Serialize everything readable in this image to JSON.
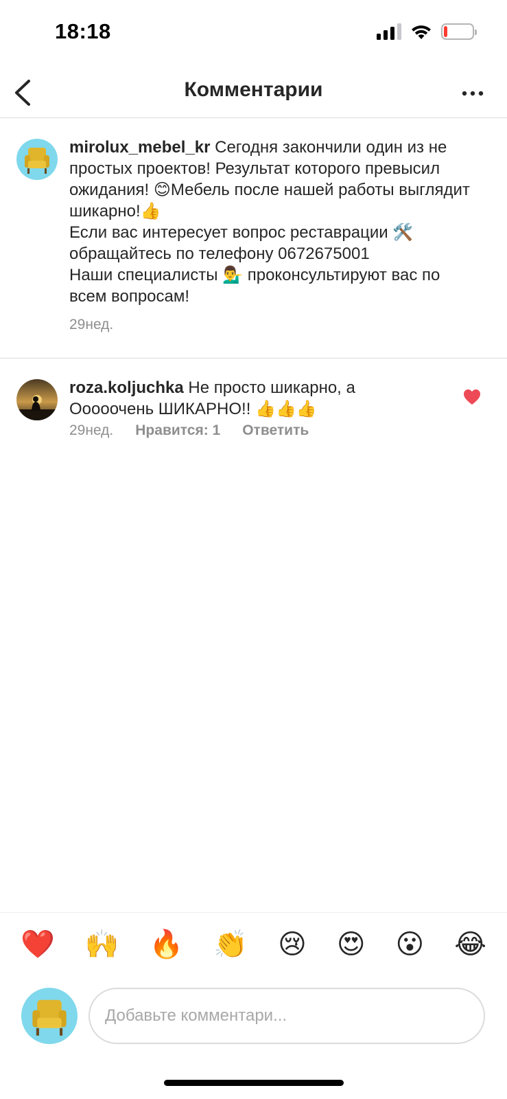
{
  "status_bar": {
    "time": "18:18",
    "battery_level": 0.12,
    "battery_color": "#ff3b30"
  },
  "header": {
    "title": "Комментарии",
    "back_icon": "chevron-left-icon",
    "more_icon": "more-horizontal-icon"
  },
  "comments": [
    {
      "username": "mirolux_mebel_kr",
      "text": "Сегодня закончили один из не простых проектов! Результат которого превысил ожидания! 😊Мебель после нашей работы выглядит шикарно!👍\nЕсли вас интересует вопрос реставрации 🛠️ обращайтесь по телефону 0672675001\nНаши специалисты 💁‍♂️ проконсультируют вас по всем вопросам!",
      "time": "29нед.",
      "avatar_icon": "yellow-armchair-avatar"
    },
    {
      "username": "roza.koljuchka",
      "text": "Не просто шикарно, а Ооооочень ШИКАРНО!! 👍👍👍",
      "time": "29нед.",
      "likes": "Нравится: 1",
      "reply": "Ответить",
      "liked": true,
      "like_color": "#ed4956",
      "avatar_icon": "silhouette-sunset-avatar"
    }
  ],
  "emoji_bar": [
    "❤️",
    "🙌",
    "🔥",
    "👏",
    "😢",
    "😍",
    "😮",
    "😂"
  ],
  "composer": {
    "placeholder": "Добавьте комментари..."
  }
}
